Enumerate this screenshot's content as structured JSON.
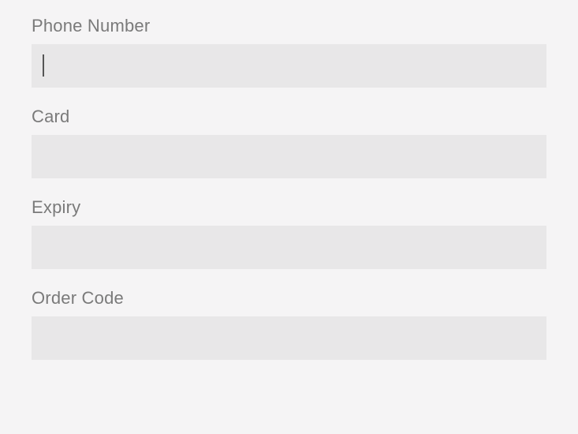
{
  "form": {
    "phone": {
      "label": "Phone Number",
      "value": ""
    },
    "card": {
      "label": "Card",
      "value": ""
    },
    "expiry": {
      "label": "Expiry",
      "value": ""
    },
    "order_code": {
      "label": "Order Code",
      "value": ""
    }
  }
}
